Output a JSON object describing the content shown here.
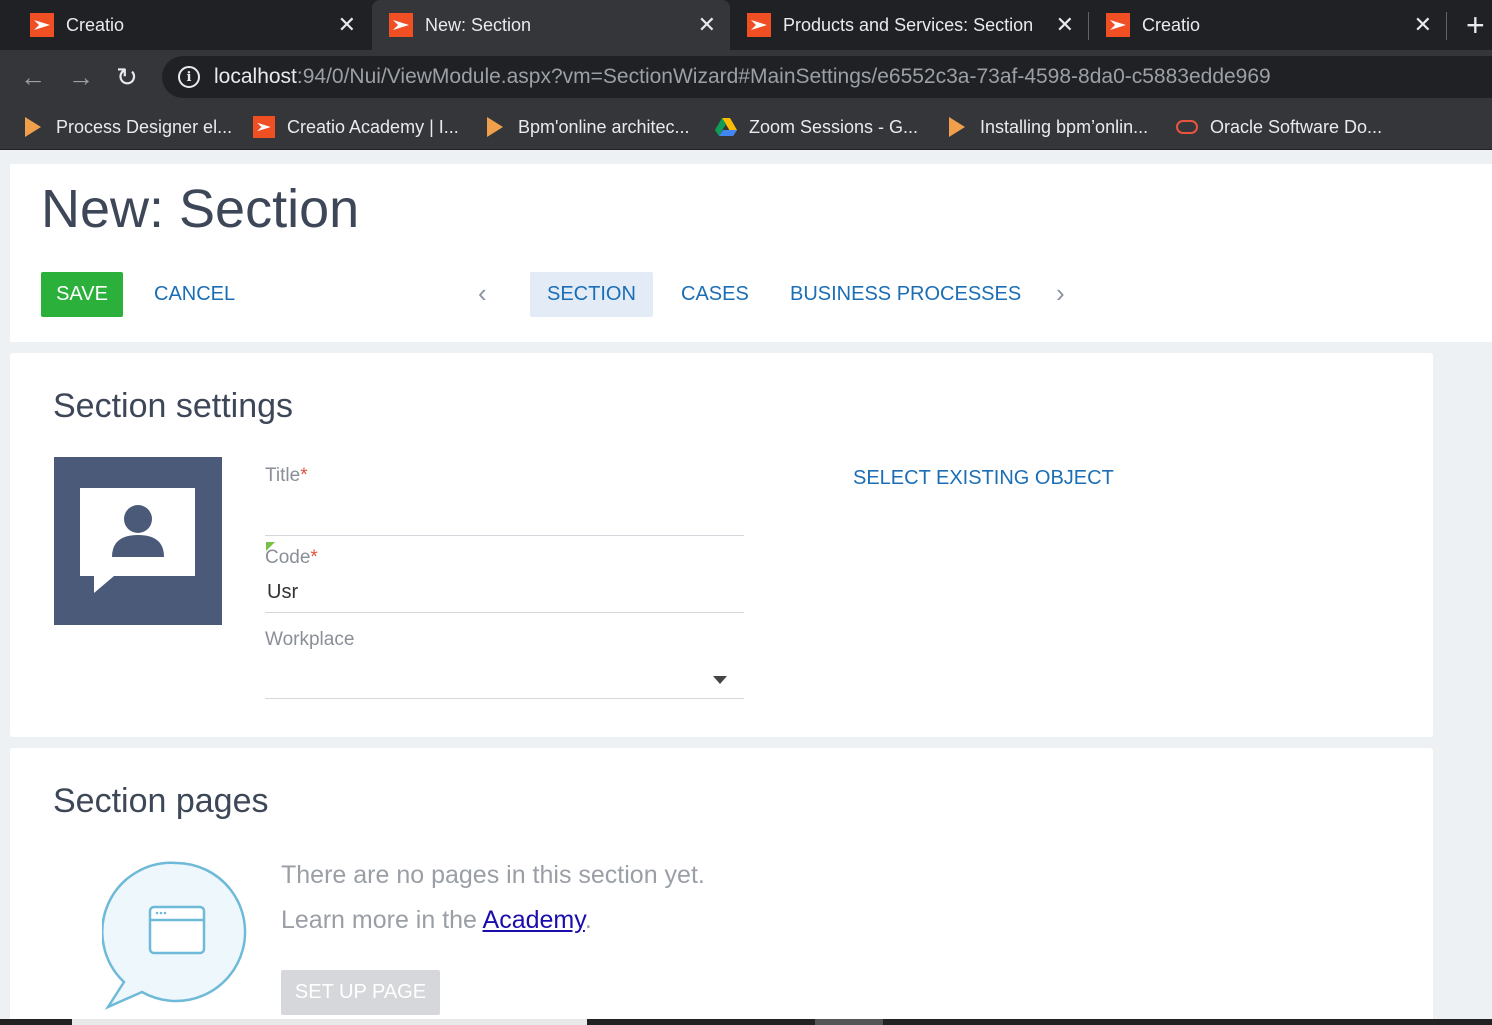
{
  "browser": {
    "tabs": [
      {
        "title": "Creatio",
        "close": "✕"
      },
      {
        "title": "New: Section",
        "close": "✕"
      },
      {
        "title": "Products and Services: Section",
        "close": "✕"
      },
      {
        "title": "Creatio",
        "close": "✕"
      }
    ],
    "new_tab": "+",
    "nav": {
      "back": "←",
      "forward": "→",
      "reload": "↻"
    },
    "url_host": "localhost",
    "url_rest": ":94/0/Nui/ViewModule.aspx?vm=SectionWizard#MainSettings/e6552c3a-73af-4598-8da0-c5883edde969",
    "bookmarks": [
      {
        "label": "Process Designer el...",
        "icon": "play-icon"
      },
      {
        "label": "Creatio Academy | I...",
        "icon": "creatio-icon"
      },
      {
        "label": "Bpm'online architec...",
        "icon": "play-icon"
      },
      {
        "label": "Zoom Sessions - G...",
        "icon": "drive-icon"
      },
      {
        "label": "Installing bpm’onlin...",
        "icon": "play-icon"
      },
      {
        "label": "Oracle Software Do...",
        "icon": "oracle-icon"
      }
    ]
  },
  "header": {
    "title": "New: Section",
    "save": "SAVE",
    "cancel": "CANCEL",
    "prev": "‹",
    "next": "›",
    "tabs": [
      "SECTION",
      "CASES",
      "BUSINESS PROCESSES"
    ]
  },
  "settings": {
    "title": "Section settings",
    "title_label": "Title",
    "code_label": "Code",
    "code_value": "Usr",
    "workplace_label": "Workplace",
    "required_mark": "*",
    "select_existing": "SELECT EXISTING OBJECT"
  },
  "pages": {
    "title": "Section pages",
    "empty_line1": "There are no pages in this section yet.",
    "empty_line2_prefix": "Learn more in the ",
    "academy_link": "Academy",
    "empty_line2_suffix": ".",
    "setup_button": "SET UP PAGE"
  },
  "colors": {
    "accent": "#1b6eb5",
    "save": "#2bb03b",
    "brand": "#f04e23"
  }
}
